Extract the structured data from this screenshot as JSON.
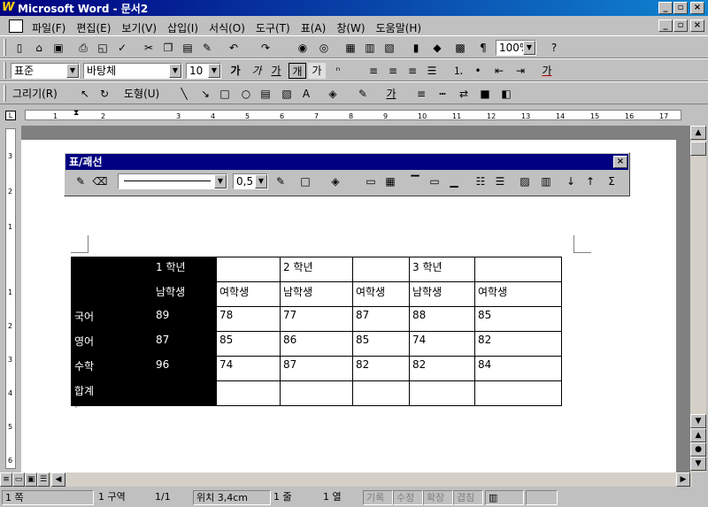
{
  "window": {
    "title": "Microsoft Word - 문서2",
    "minimize": "_",
    "maximize": "▫",
    "close": "×"
  },
  "menu": [
    "파일(F)",
    "편집(E)",
    "보기(V)",
    "삽입(I)",
    "서식(O)",
    "도구(T)",
    "표(A)",
    "창(W)",
    "도움말(H)"
  ],
  "standard_toolbar": {
    "zoom": "100%"
  },
  "format_toolbar": {
    "style": "표준",
    "font": "바탕체",
    "size": "10",
    "bold": "가",
    "italic": "가",
    "underline": "가",
    "border": "개",
    "shade": "가",
    "font_color": "가"
  },
  "draw_toolbar": {
    "draw": "그리기(R)",
    "autoshapes": "도형(U)",
    "font_color": "가"
  },
  "ruler": {
    "marks": [
      "1",
      "2",
      "3",
      "4",
      "5",
      "6",
      "7",
      "8",
      "9",
      "10",
      "11",
      "12",
      "13",
      "14",
      "15",
      "16",
      "17"
    ],
    "vmarks": [
      "3",
      "2",
      "1",
      "1",
      "2",
      "3",
      "4",
      "5",
      "6"
    ]
  },
  "tables_borders": {
    "title": "표/괘선",
    "line_weight": "0,5",
    "sum_icon": "Σ"
  },
  "table": {
    "rows": [
      [
        "",
        "1 학년",
        "",
        "2 학년",
        "",
        "3 학년",
        ""
      ],
      [
        "",
        "남학생",
        "여학생",
        "남학생",
        "여학생",
        "남학생",
        "여학생"
      ],
      [
        "국어",
        "89",
        "78",
        "77",
        "87",
        "88",
        "85"
      ],
      [
        "영어",
        "87",
        "85",
        "86",
        "85",
        "74",
        "82"
      ],
      [
        "수학",
        "96",
        "74",
        "87",
        "82",
        "82",
        "84"
      ],
      [
        "합계",
        "",
        "",
        "",
        "",
        "",
        ""
      ]
    ]
  },
  "status": {
    "page": "1 쪽",
    "section": "1 구역",
    "pages": "1/1",
    "position": "위치 3,4cm",
    "line": "1 줄",
    "column": "1 열",
    "rec": "기록",
    "trk": "수정",
    "ext": "확장",
    "ovr": "겹침"
  }
}
